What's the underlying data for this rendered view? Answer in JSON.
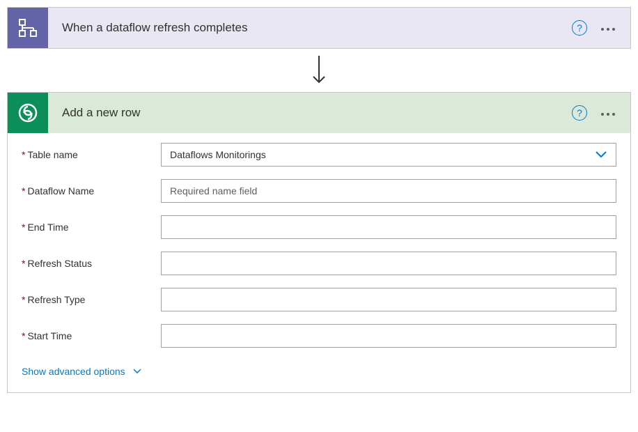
{
  "trigger": {
    "title": "When a dataflow refresh completes"
  },
  "action": {
    "title": "Add a new row",
    "fields": {
      "table_name": {
        "label": "Table name",
        "value": "Dataflows Monitorings"
      },
      "dataflow_name": {
        "label": "Dataflow Name",
        "placeholder": "Required name field",
        "value": ""
      },
      "end_time": {
        "label": "End Time",
        "value": ""
      },
      "refresh_status": {
        "label": "Refresh Status",
        "value": ""
      },
      "refresh_type": {
        "label": "Refresh Type",
        "value": ""
      },
      "start_time": {
        "label": "Start Time",
        "value": ""
      }
    },
    "advanced_label": "Show advanced options"
  },
  "icons": {
    "help_glyph": "?"
  }
}
